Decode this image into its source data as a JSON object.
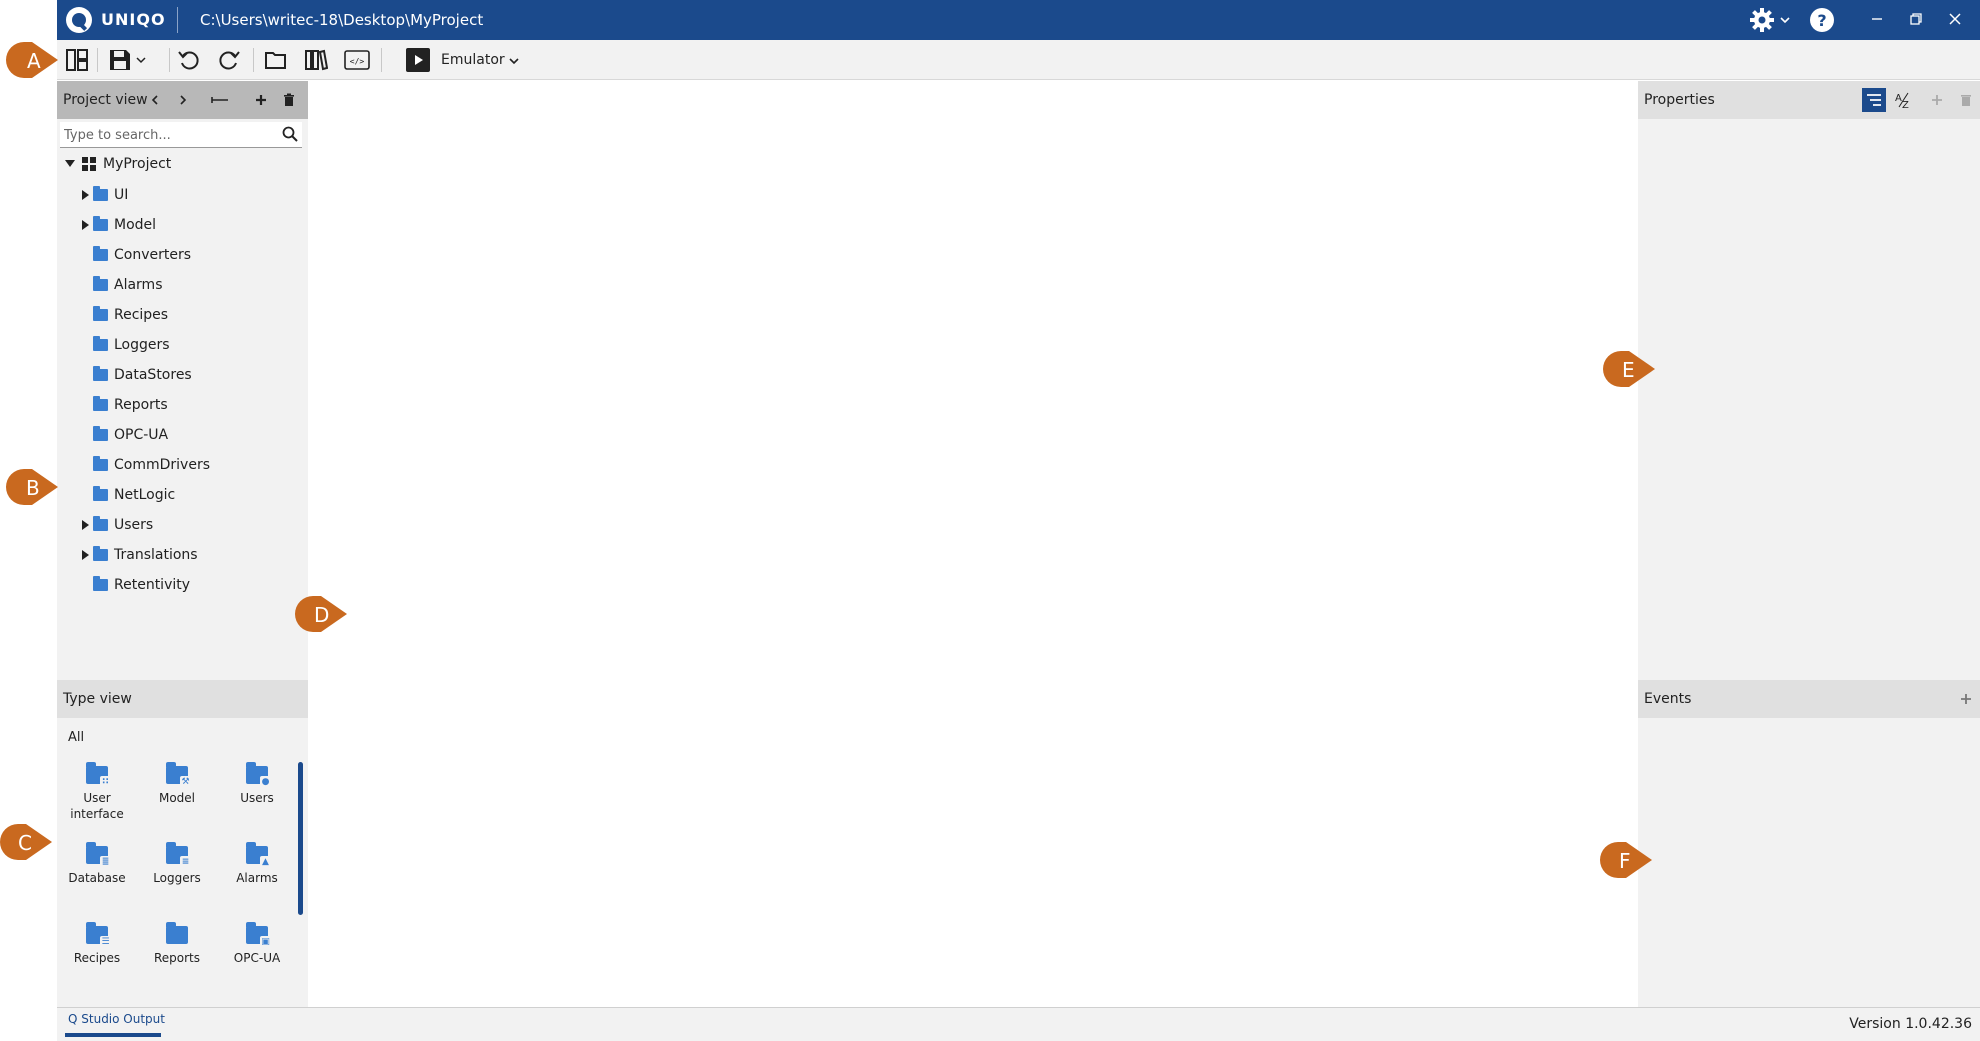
{
  "titlebar": {
    "app_name": "UNIQO",
    "project_path": "C:\\Users\\writec-18\\Desktop\\MyProject"
  },
  "toolbar": {
    "emulator_label": "Emulator"
  },
  "project_view": {
    "title": "Project view",
    "search_placeholder": "Type to search...",
    "root": "MyProject",
    "items": [
      {
        "label": "UI",
        "expandable": true
      },
      {
        "label": "Model",
        "expandable": true
      },
      {
        "label": "Converters",
        "expandable": false
      },
      {
        "label": "Alarms",
        "expandable": false
      },
      {
        "label": "Recipes",
        "expandable": false
      },
      {
        "label": "Loggers",
        "expandable": false
      },
      {
        "label": "DataStores",
        "expandable": false
      },
      {
        "label": "Reports",
        "expandable": false
      },
      {
        "label": "OPC-UA",
        "expandable": false
      },
      {
        "label": "CommDrivers",
        "expandable": false
      },
      {
        "label": "NetLogic",
        "expandable": false
      },
      {
        "label": "Users",
        "expandable": true
      },
      {
        "label": "Translations",
        "expandable": true
      },
      {
        "label": "Retentivity",
        "expandable": false
      }
    ]
  },
  "type_view": {
    "title": "Type view",
    "filter": "All",
    "items": [
      {
        "label": "User interface",
        "icon": "user-interface-folder-icon"
      },
      {
        "label": "Model",
        "icon": "model-folder-icon"
      },
      {
        "label": "Users",
        "icon": "users-folder-icon"
      },
      {
        "label": "Database",
        "icon": "database-folder-icon"
      },
      {
        "label": "Loggers",
        "icon": "loggers-folder-icon"
      },
      {
        "label": "Alarms",
        "icon": "alarms-folder-icon"
      },
      {
        "label": "Recipes",
        "icon": "recipes-folder-icon"
      },
      {
        "label": "Reports",
        "icon": "reports-folder-icon"
      },
      {
        "label": "OPC-UA",
        "icon": "opcua-folder-icon"
      }
    ]
  },
  "properties": {
    "title": "Properties"
  },
  "events": {
    "title": "Events"
  },
  "callouts": {
    "a": "A",
    "b": "B",
    "c": "C",
    "d": "D",
    "e": "E",
    "f": "F"
  },
  "statusbar": {
    "output_tab": "Q Studio Output",
    "version": "Version 1.0.42.36"
  },
  "colors": {
    "titlebar": "#1b4a8c",
    "accent": "#3a7fd0",
    "callout": "#c9691f"
  }
}
